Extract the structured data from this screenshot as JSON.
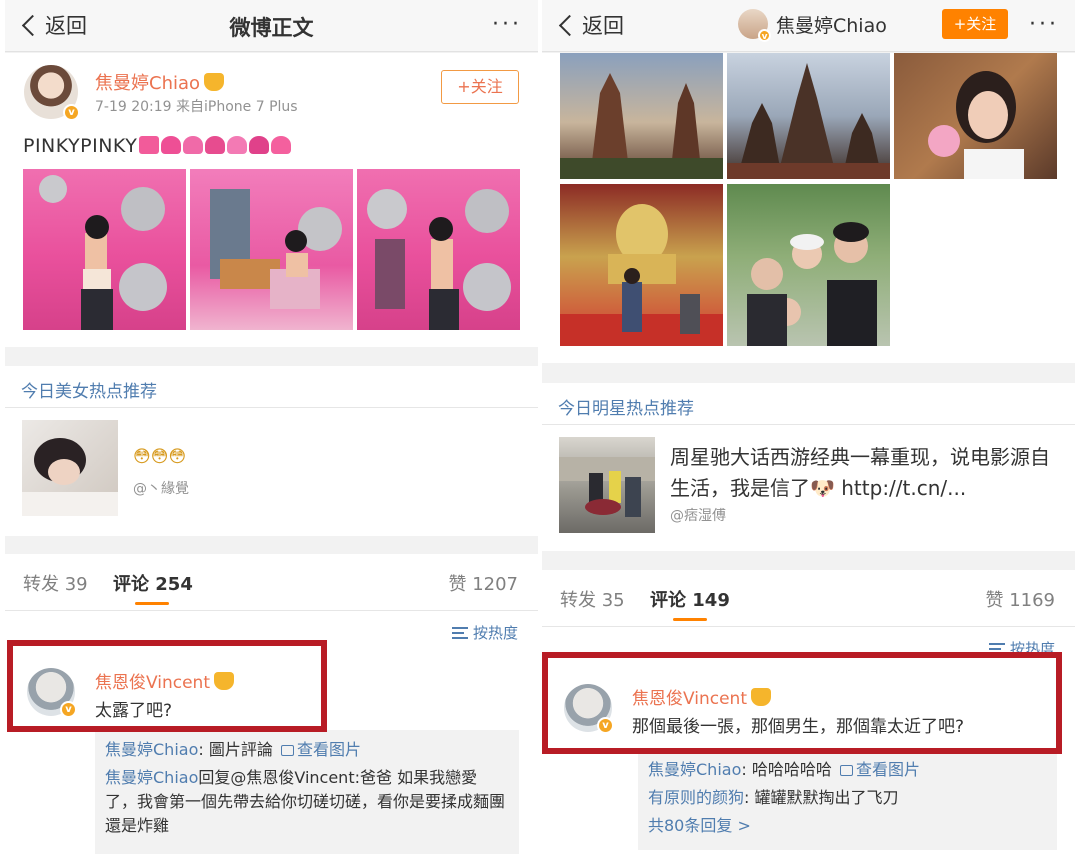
{
  "left": {
    "nav": {
      "back": "返回",
      "title": "微博正文",
      "more": "···"
    },
    "post": {
      "author": "焦曼婷Chiao",
      "meta": "7-19 20:19  来自iPhone 7 Plus",
      "follow": "+关注",
      "text": "PINKYPINKY"
    },
    "rec": {
      "title": "今日美女热点推荐",
      "text": "😳😳😳",
      "author": "@丶緣覺"
    },
    "stats": {
      "repost": "转发 39",
      "comment": "评论 254",
      "like": "赞 1207"
    },
    "sort": "按热度",
    "comment": {
      "name": "焦恩俊Vincent",
      "text": "太露了吧?",
      "replies": [
        {
          "name": "焦曼婷Chiao",
          "text": ": 圖片評論 ",
          "link": "查看图片"
        },
        {
          "name": "焦曼婷Chiao",
          "text": "回复@焦恩俊Vincent:爸爸 如果我戀愛了，我會第一個先帶去給你切磋切磋，看你是要揉成麵團還是炸雞"
        }
      ]
    }
  },
  "right": {
    "nav": {
      "back": "返回",
      "username": "焦曼婷Chiao",
      "follow": "+关注",
      "more": "···"
    },
    "rec": {
      "title": "今日明星热点推荐",
      "text": "周星驰大话西游经典一幕重现，说电影源自生活，我是信了🐶 http://t.cn/...",
      "author": "@痞湿傅"
    },
    "stats": {
      "repost": "转发 35",
      "comment": "评论 149",
      "like": "赞 1169"
    },
    "sort": "按热度",
    "comment": {
      "name": "焦恩俊Vincent",
      "text": "那個最後一張，那個男生，那個靠太近了吧?",
      "replies": [
        {
          "name": "焦曼婷Chiao",
          "text": ": 哈哈哈哈哈 ",
          "link": "查看图片"
        },
        {
          "name": "有原则的颜狗",
          "text": ": 罐罐默默掏出了飞刀"
        }
      ],
      "more": "共80条回复 >"
    }
  },
  "colors": {
    "accent": "#ff8200",
    "name": "#eb7350",
    "link": "#507daf",
    "highlight": "#b81c25"
  }
}
